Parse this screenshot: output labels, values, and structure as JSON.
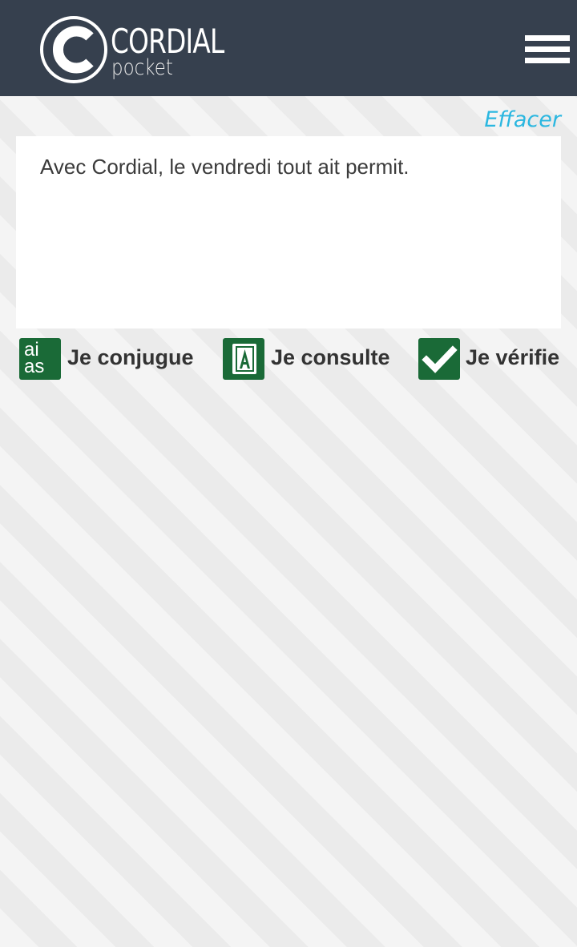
{
  "header": {
    "logo_text": "CORDIAL",
    "logo_subtext": "pocket",
    "menu_icon": "hamburger-menu-icon"
  },
  "editor": {
    "clear_label": "Effacer",
    "text": "Avec Cordial, le vendredi tout ait permit."
  },
  "actions": [
    {
      "label": "Je conjugue",
      "icon": "conjugation-icon",
      "icon_text_1": "ai",
      "icon_text_2": "as"
    },
    {
      "label": "Je consulte",
      "icon": "dictionary-book-icon",
      "icon_text": "A"
    },
    {
      "label": "Je vérifie",
      "icon": "checkmark-icon"
    }
  ],
  "colors": {
    "header_bg": "#36404e",
    "accent": "#2bb7e0",
    "action_icon_bg": "#1a6a37"
  }
}
